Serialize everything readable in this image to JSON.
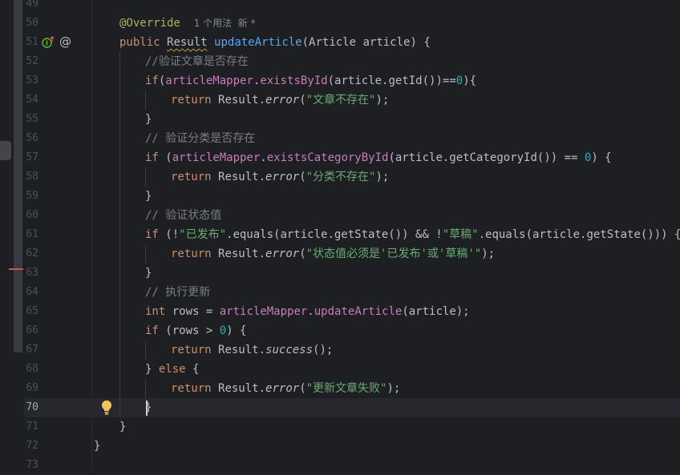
{
  "editor": {
    "current_line": "70",
    "lines": [
      {
        "n": "49"
      },
      {
        "n": "50",
        "annotation": "@Override",
        "hint": "1 个用法  新 *"
      },
      {
        "n": "51",
        "kw": "public",
        "type": "Result",
        "method": "updateArticle",
        "params": "(Article article) {"
      },
      {
        "n": "52",
        "comment": "//验证文章是否存在"
      },
      {
        "n": "53",
        "kw": "if",
        "p1": "(",
        "field": "articleMapper",
        "dot": ".",
        "call": "existsById",
        "args": "(article.getId())==",
        "num": "0",
        "tail": "){"
      },
      {
        "n": "54",
        "kw": "return",
        "cls": "Result.",
        "call": "error",
        "open": "(",
        "str": "\"文章不存在\"",
        "tail": ");"
      },
      {
        "n": "55",
        "text": "}"
      },
      {
        "n": "56",
        "comment": "// 验证分类是否存在"
      },
      {
        "n": "57",
        "kw": "if",
        "p1": " (",
        "field": "articleMapper",
        "dot": ".",
        "call": "existsCategoryById",
        "args": "(article.getCategoryId()) == ",
        "num": "0",
        "tail": ") {"
      },
      {
        "n": "58",
        "kw": "return",
        "cls": "Result.",
        "call": "error",
        "open": "(",
        "str": "\"分类不存在\"",
        "tail": ");"
      },
      {
        "n": "59",
        "text": "}"
      },
      {
        "n": "60",
        "comment": "// 验证状态值"
      },
      {
        "n": "61",
        "kw": "if",
        "a": " (!",
        "s1": "\"已发布\"",
        "b": ".equals(article.getState()) && !",
        "s2": "\"草稿\"",
        "c": ".equals(article.getState())) {"
      },
      {
        "n": "62",
        "kw": "return",
        "cls": "Result.",
        "call": "error",
        "open": "(",
        "str": "\"状态值必须是'已发布'或'草稿'\"",
        "tail": ");"
      },
      {
        "n": "63",
        "text": "}"
      },
      {
        "n": "64",
        "comment": "// 执行更新"
      },
      {
        "n": "65",
        "kw": "int",
        "mid": " rows = ",
        "field": "articleMapper",
        "dot": ".",
        "call": "updateArticle",
        "tail": "(article);"
      },
      {
        "n": "66",
        "kw": "if",
        "mid": " (rows > ",
        "num": "0",
        "tail": ") {"
      },
      {
        "n": "67",
        "kw": "return",
        "cls": "Result.",
        "call": "success",
        "tail": "();"
      },
      {
        "n": "68",
        "pre": "} ",
        "kw": "else",
        "tail": " {"
      },
      {
        "n": "69",
        "kw": "return",
        "cls": "Result.",
        "call": "error",
        "open": "(",
        "str": "\"更新文章失败\"",
        "tail": ");"
      },
      {
        "n": "70",
        "text": "}"
      },
      {
        "n": "71",
        "text": "}"
      },
      {
        "n": "72",
        "text": "}"
      },
      {
        "n": "73"
      }
    ]
  },
  "colors": {
    "background": "#1e1f22",
    "keyword": "#cf8e6d",
    "method": "#56a8f5",
    "field": "#c77dbb",
    "string": "#6aab73",
    "number": "#2aacb8",
    "comment": "#7a7e85",
    "annotation": "#b3ae60"
  },
  "icons": [
    "implement-up-icon",
    "at-annotation-icon",
    "lightbulb-icon"
  ]
}
